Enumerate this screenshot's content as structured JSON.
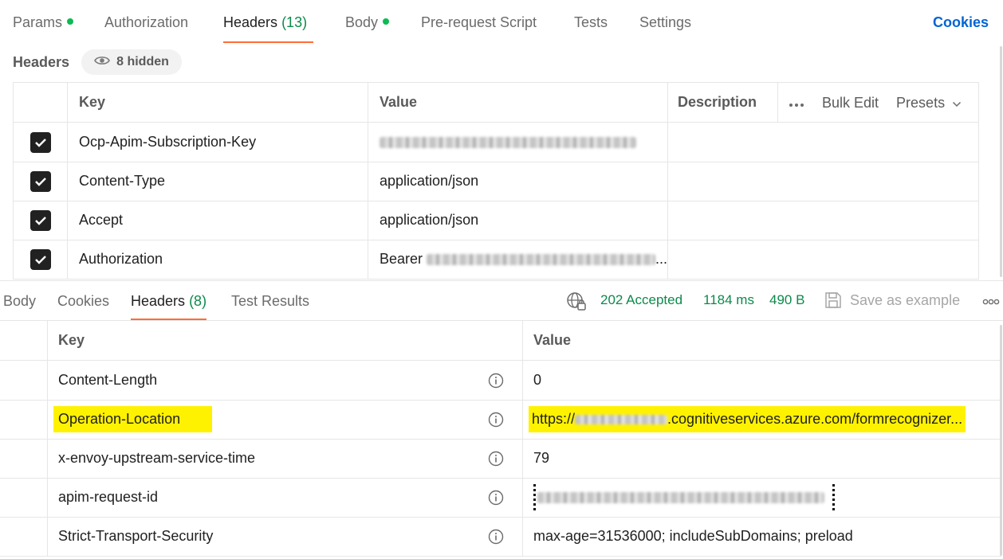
{
  "request_tabs": {
    "params": "Params",
    "authorization": "Authorization",
    "headers": "Headers",
    "headers_count": "(13)",
    "body": "Body",
    "pre_request": "Pre-request Script",
    "tests": "Tests",
    "settings": "Settings",
    "cookies": "Cookies"
  },
  "headers_section": {
    "title": "Headers",
    "hidden_label": "8 hidden"
  },
  "request_table": {
    "columns": [
      "Key",
      "Value",
      "Description"
    ],
    "actions": {
      "bulk_edit": "Bulk Edit",
      "presets": "Presets"
    },
    "rows": [
      {
        "key": "Ocp-Apim-Subscription-Key",
        "value": "",
        "checked": true
      },
      {
        "key": "Content-Type",
        "value": "application/json",
        "checked": true
      },
      {
        "key": "Accept",
        "value": "application/json",
        "checked": true
      },
      {
        "key": "Authorization",
        "value": "Bearer",
        "checked": true
      }
    ]
  },
  "response_tabs": {
    "body": "Body",
    "cookies": "Cookies",
    "headers": "Headers",
    "headers_count": "(8)",
    "test_results": "Test Results"
  },
  "response_status": {
    "status": "202 Accepted",
    "time": "1184 ms",
    "size": "490 B",
    "save_as_example": "Save as example"
  },
  "response_table": {
    "columns": [
      "Key",
      "Value"
    ],
    "rows": [
      {
        "key": "Content-Length",
        "value": "0"
      },
      {
        "key": "Operation-Location",
        "value_prefix": "https://",
        "value_suffix": ".cognitiveservices.azure.com/formrecognizer..."
      },
      {
        "key": "x-envoy-upstream-service-time",
        "value": "79"
      },
      {
        "key": "apim-request-id",
        "value": ""
      },
      {
        "key": "Strict-Transport-Security",
        "value": "max-age=31536000; includeSubDomains; preload"
      }
    ]
  },
  "colors": {
    "accent_tab": "#ff6c37",
    "status_green": "#0c8a4b",
    "dot_green": "#0cbb52",
    "link_blue": "#0265d2",
    "highlight": "#fff200"
  },
  "icons": [
    "eye-icon",
    "checkmark-icon",
    "more-icon",
    "chevron-down-icon",
    "globe-lock-icon",
    "save-icon",
    "info-icon"
  ]
}
